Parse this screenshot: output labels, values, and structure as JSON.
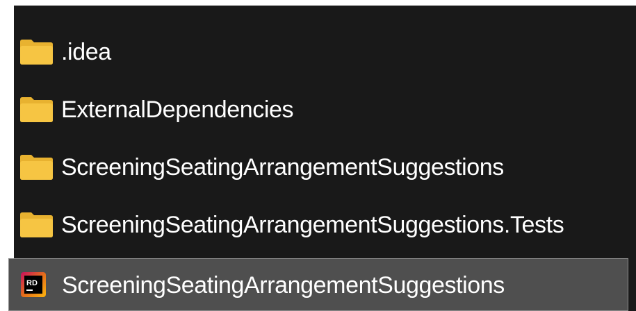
{
  "colors": {
    "background": "#191919",
    "selected_background": "#4f4f4f",
    "selected_border": "#8c8c8c",
    "folder": "#f6c543",
    "text": "#ffffff"
  },
  "items": [
    {
      "label": ".idea",
      "icon": "folder-icon",
      "selected": false
    },
    {
      "label": "ExternalDependencies",
      "icon": "folder-icon",
      "selected": false
    },
    {
      "label": "ScreeningSeatingArrangementSuggestions",
      "icon": "folder-icon",
      "selected": false
    },
    {
      "label": "ScreeningSeatingArrangementSuggestions.Tests",
      "icon": "folder-icon",
      "selected": false
    },
    {
      "label": "ScreeningSeatingArrangementSuggestions",
      "icon": "rider-solution-icon",
      "icon_text": "RD",
      "selected": true
    }
  ]
}
